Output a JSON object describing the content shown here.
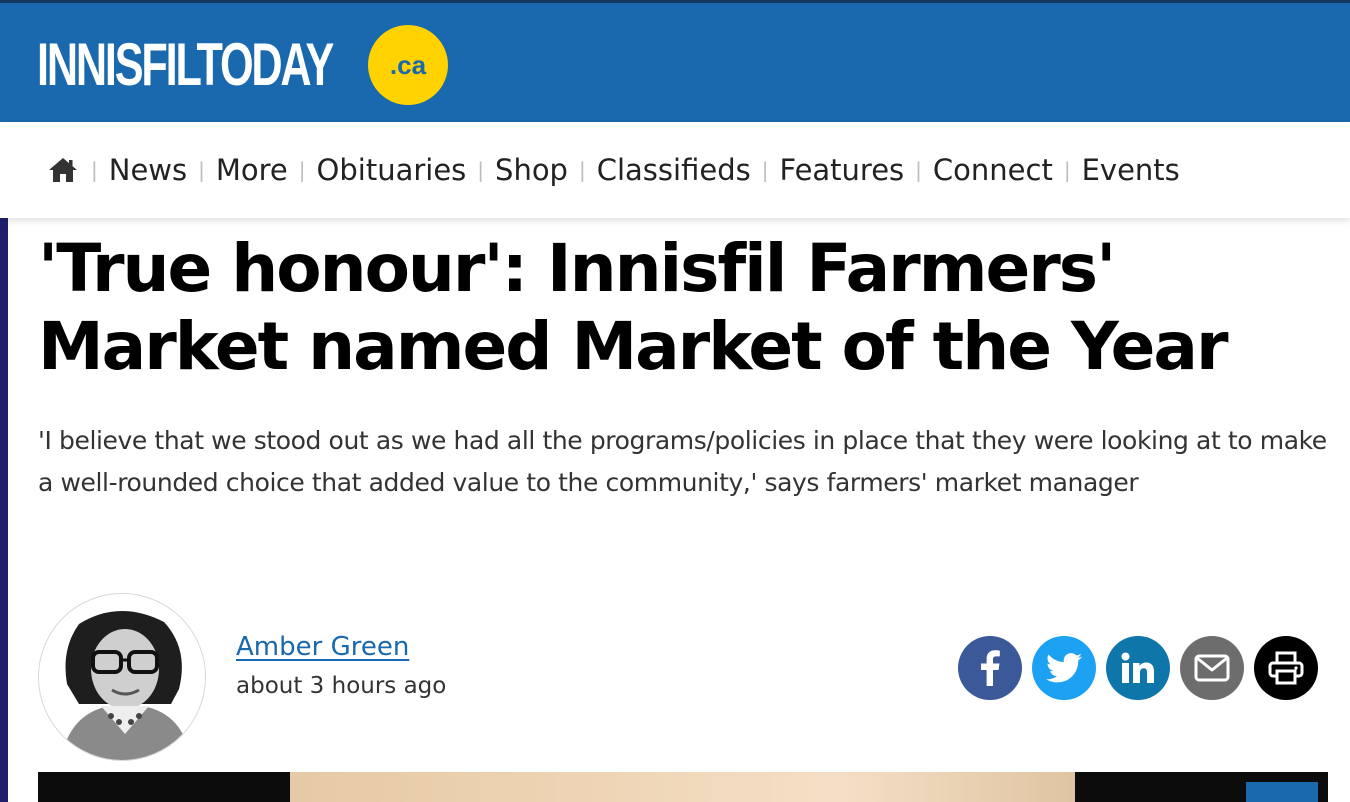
{
  "site": {
    "logo_text": "INNISFILTODAY",
    "logo_badge": ".ca"
  },
  "nav": {
    "items": [
      {
        "label": "News"
      },
      {
        "label": "More"
      },
      {
        "label": "Obituaries"
      },
      {
        "label": "Shop"
      },
      {
        "label": "Classifieds"
      },
      {
        "label": "Features"
      },
      {
        "label": "Connect"
      },
      {
        "label": "Events"
      }
    ]
  },
  "article": {
    "headline": "'True honour': Innisfil Farmers' Market named Market of the Year",
    "subhead": "'I believe that we stood out as we had all the programs/policies in place that they were looking at to make a well-rounded choice that added value to the community,' says farmers' market manager",
    "author": "Amber Green",
    "timestamp": "about 3 hours ago"
  },
  "share_buttons": [
    {
      "icon": "facebook-icon",
      "color": "#3b5998"
    },
    {
      "icon": "twitter-icon",
      "color": "#1da1f2"
    },
    {
      "icon": "linkedin-icon",
      "color": "#0e76a8"
    },
    {
      "icon": "email-icon",
      "color": "#6d6d6d"
    },
    {
      "icon": "print-icon",
      "color": "#000000"
    }
  ],
  "colors": {
    "brand_blue": "#1a68ad",
    "badge_yellow": "#ffd200",
    "author_link": "#1a68ad"
  }
}
